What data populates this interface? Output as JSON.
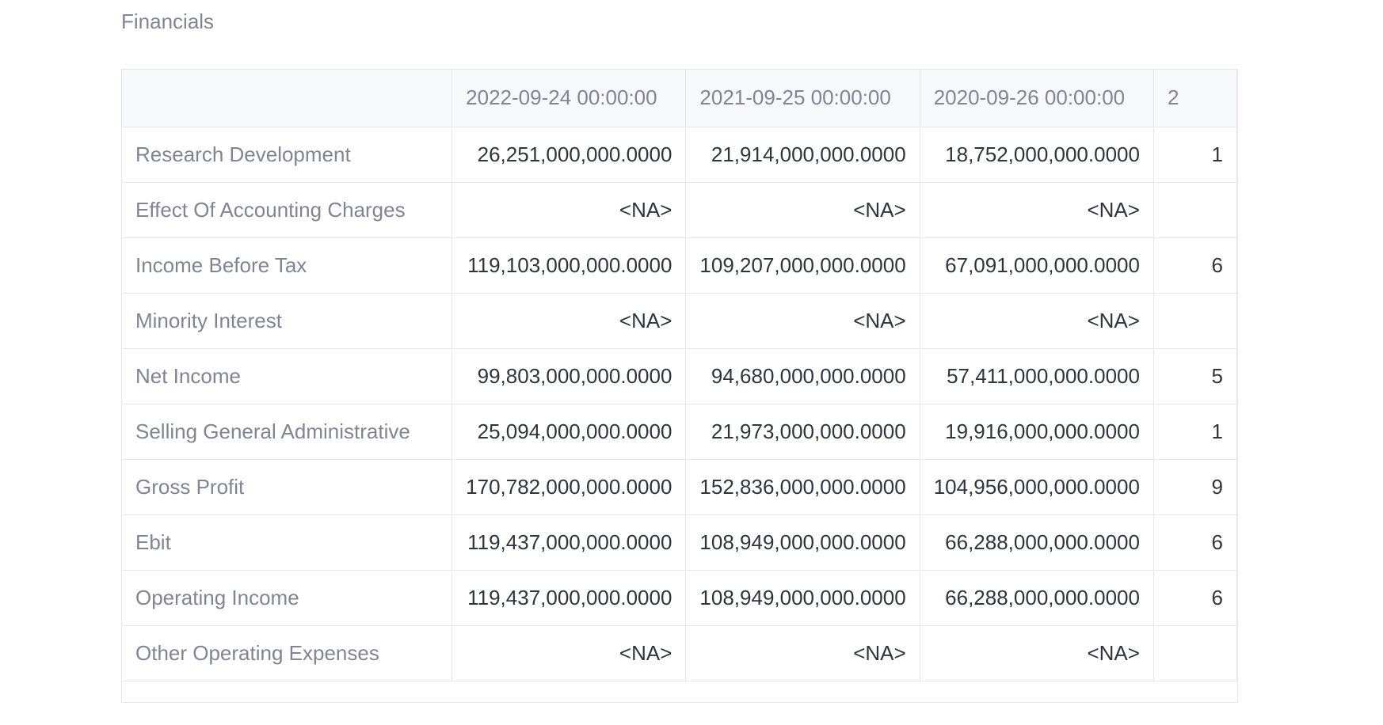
{
  "section_title": "Financials",
  "table": {
    "columns": [
      "",
      "2022-09-24 00:00:00",
      "2021-09-25 00:00:00",
      "2020-09-26 00:00:00",
      "2"
    ],
    "rows": [
      {
        "label": "Research Development",
        "values": [
          "26,251,000,000.0000",
          "21,914,000,000.0000",
          "18,752,000,000.0000",
          "1"
        ]
      },
      {
        "label": "Effect Of Accounting Charges",
        "values": [
          "<NA>",
          "<NA>",
          "<NA>",
          ""
        ]
      },
      {
        "label": "Income Before Tax",
        "values": [
          "119,103,000,000.0000",
          "109,207,000,000.0000",
          "67,091,000,000.0000",
          "6"
        ]
      },
      {
        "label": "Minority Interest",
        "values": [
          "<NA>",
          "<NA>",
          "<NA>",
          ""
        ]
      },
      {
        "label": "Net Income",
        "values": [
          "99,803,000,000.0000",
          "94,680,000,000.0000",
          "57,411,000,000.0000",
          "5"
        ]
      },
      {
        "label": "Selling General Administrative",
        "values": [
          "25,094,000,000.0000",
          "21,973,000,000.0000",
          "19,916,000,000.0000",
          "1"
        ]
      },
      {
        "label": "Gross Profit",
        "values": [
          "170,782,000,000.0000",
          "152,836,000,000.0000",
          "104,956,000,000.0000",
          "9"
        ]
      },
      {
        "label": "Ebit",
        "values": [
          "119,437,000,000.0000",
          "108,949,000,000.0000",
          "66,288,000,000.0000",
          "6"
        ]
      },
      {
        "label": "Operating Income",
        "values": [
          "119,437,000,000.0000",
          "108,949,000,000.0000",
          "66,288,000,000.0000",
          "6"
        ]
      },
      {
        "label": "Other Operating Expenses",
        "values": [
          "<NA>",
          "<NA>",
          "<NA>",
          ""
        ]
      }
    ]
  }
}
